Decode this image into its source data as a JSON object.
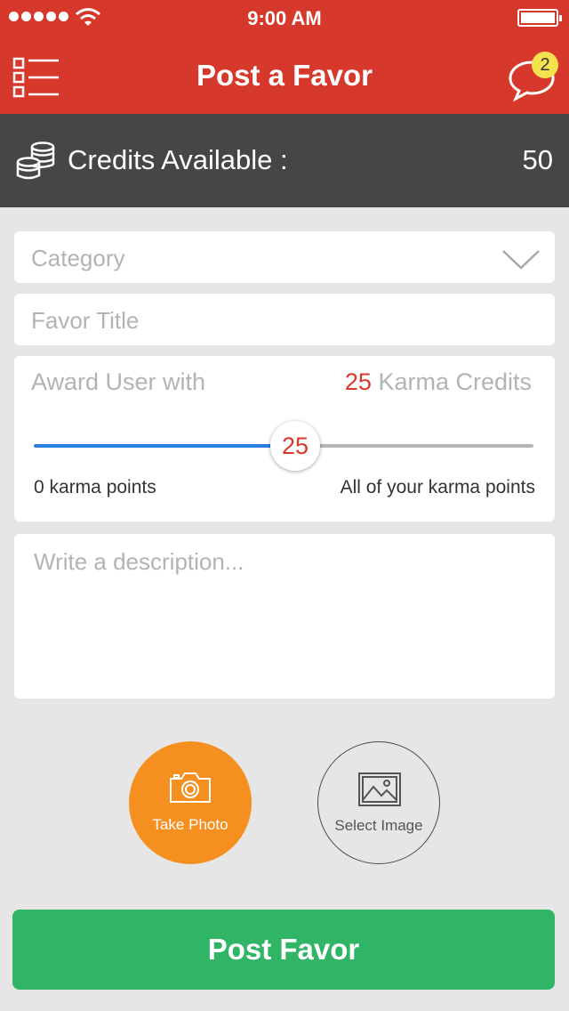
{
  "status_bar": {
    "time": "9:00 AM"
  },
  "header": {
    "title": "Post a Favor",
    "notification_count": "2"
  },
  "credits": {
    "label": "Credits Available :",
    "value": "50"
  },
  "form": {
    "category_placeholder": "Category",
    "title_placeholder": "Favor Title",
    "award": {
      "label": "Award User with",
      "amount": "25",
      "unit": "Karma Credits",
      "slider_value": "25",
      "slider_min_label": "0 karma points",
      "slider_max_label": "All of your karma points",
      "slider_fraction": 0.5
    },
    "description_placeholder": "Write a description..."
  },
  "media": {
    "take_photo": "Take Photo",
    "select_image": "Select Image"
  },
  "submit": {
    "label": "Post Favor"
  },
  "colors": {
    "header": "#d6392b",
    "credits_bar": "#464646",
    "take_photo": "#f58f1f",
    "submit": "#30b466",
    "slider": "#2b7fe0",
    "badge": "#f4e14d"
  },
  "icons": [
    "signal-dots-icon",
    "wifi-icon",
    "battery-icon",
    "list-menu-icon",
    "chat-bubble-icon",
    "coins-icon",
    "chevron-down-icon",
    "camera-icon",
    "image-icon"
  ]
}
